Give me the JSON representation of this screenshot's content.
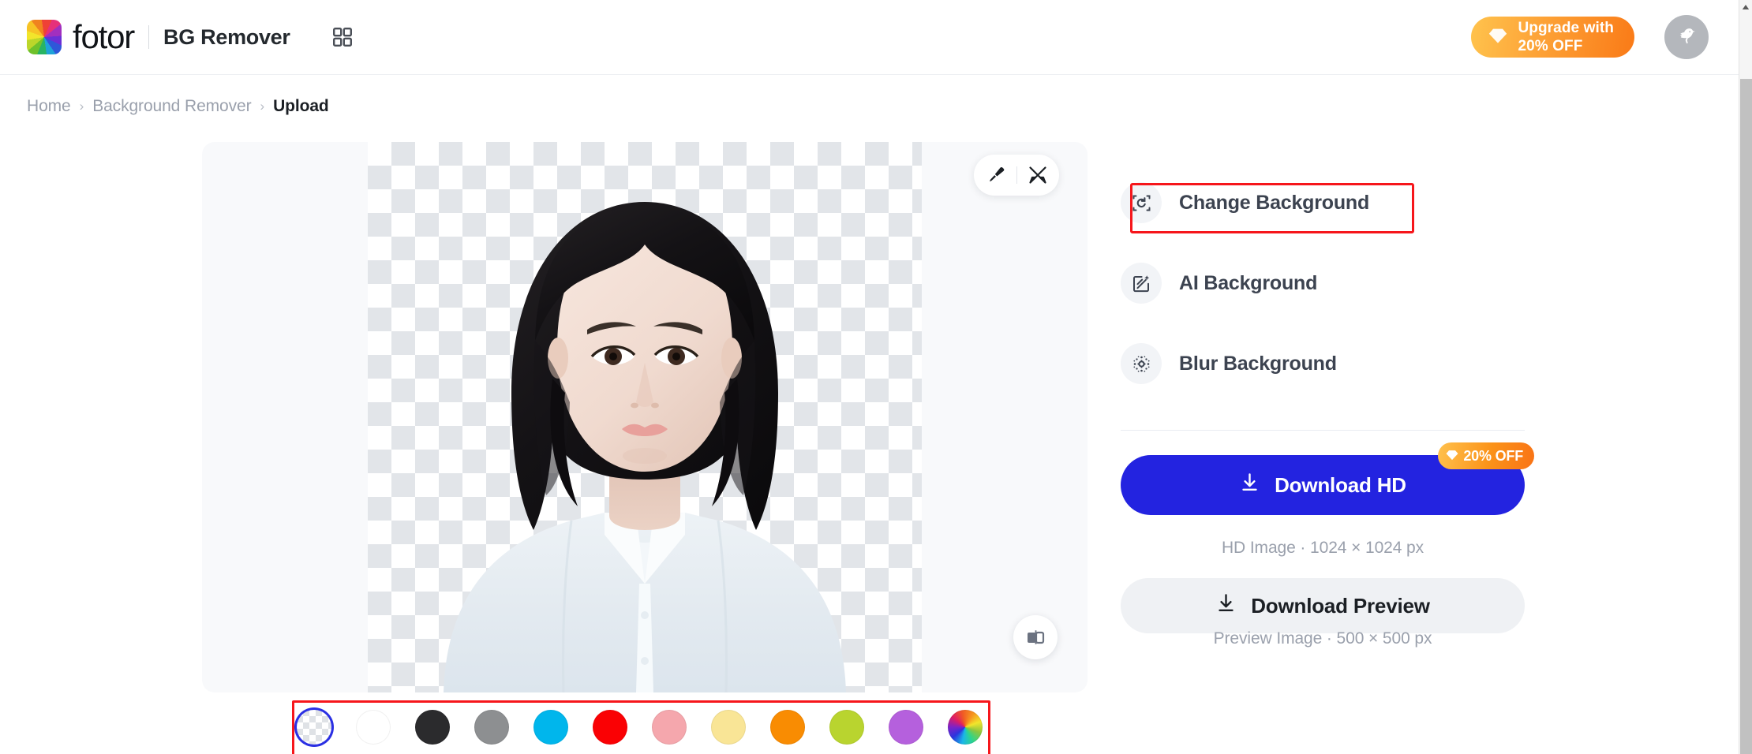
{
  "header": {
    "logo_icon": "fotor-pinwheel-logo",
    "brand": "fotor",
    "app_name": "BG Remover",
    "apps_icon": "grid-apps-icon",
    "upgrade": {
      "icon": "diamond-icon",
      "label": "Upgrade with\n20% OFF"
    },
    "avatar_icon": "bird-avatar-icon"
  },
  "breadcrumb": {
    "items": [
      {
        "label": "Home",
        "current": false
      },
      {
        "label": "Background Remover",
        "current": false
      },
      {
        "label": "Upload",
        "current": true
      }
    ],
    "separator": "›"
  },
  "canvas": {
    "background_type": "transparent-checkerboard",
    "image_alt": "portrait of a woman with short black hair wearing a white shirt",
    "tools": [
      {
        "name": "brush-tool",
        "icon": "paintbrush-icon"
      },
      {
        "name": "erase-restore-tool",
        "icon": "crossed-tools-icon"
      }
    ],
    "compare_button": {
      "name": "compare-before-after",
      "icon": "split-compare-icon"
    }
  },
  "swatches": {
    "selected_index": 0,
    "items": [
      {
        "name": "transparent",
        "color": "transparent"
      },
      {
        "name": "white",
        "color": "#FFFFFF"
      },
      {
        "name": "black",
        "color": "#2B2B2D"
      },
      {
        "name": "gray",
        "color": "#8D8F91"
      },
      {
        "name": "cyan",
        "color": "#00B6EC"
      },
      {
        "name": "red",
        "color": "#FA0104"
      },
      {
        "name": "pink",
        "color": "#F5A7AD"
      },
      {
        "name": "yellow",
        "color": "#F9E596"
      },
      {
        "name": "orange",
        "color": "#F98C02"
      },
      {
        "name": "yellow-green",
        "color": "#B9D42F"
      },
      {
        "name": "purple",
        "color": "#B560DD"
      },
      {
        "name": "rainbow",
        "color": "rainbow"
      }
    ]
  },
  "right_panel": {
    "options": [
      {
        "label": "Change Background",
        "icon": "change-background-icon",
        "highlighted": true
      },
      {
        "label": "AI Background",
        "icon": "ai-background-icon",
        "highlighted": false
      },
      {
        "label": "Blur Background",
        "icon": "blur-background-icon",
        "highlighted": false
      }
    ],
    "download_hd": {
      "label": "Download HD",
      "icon": "download-icon",
      "badge": "20% OFF",
      "badge_icon": "diamond-icon",
      "caption": "HD Image · 1024 × 1024 px",
      "color": "#2323E0"
    },
    "download_preview": {
      "label": "Download Preview",
      "icon": "download-icon",
      "caption": "Preview Image · 500 × 500 px"
    }
  },
  "annotations": {
    "color": "#F6161B",
    "targets": [
      "change-background-option",
      "background-color-swatches"
    ]
  }
}
